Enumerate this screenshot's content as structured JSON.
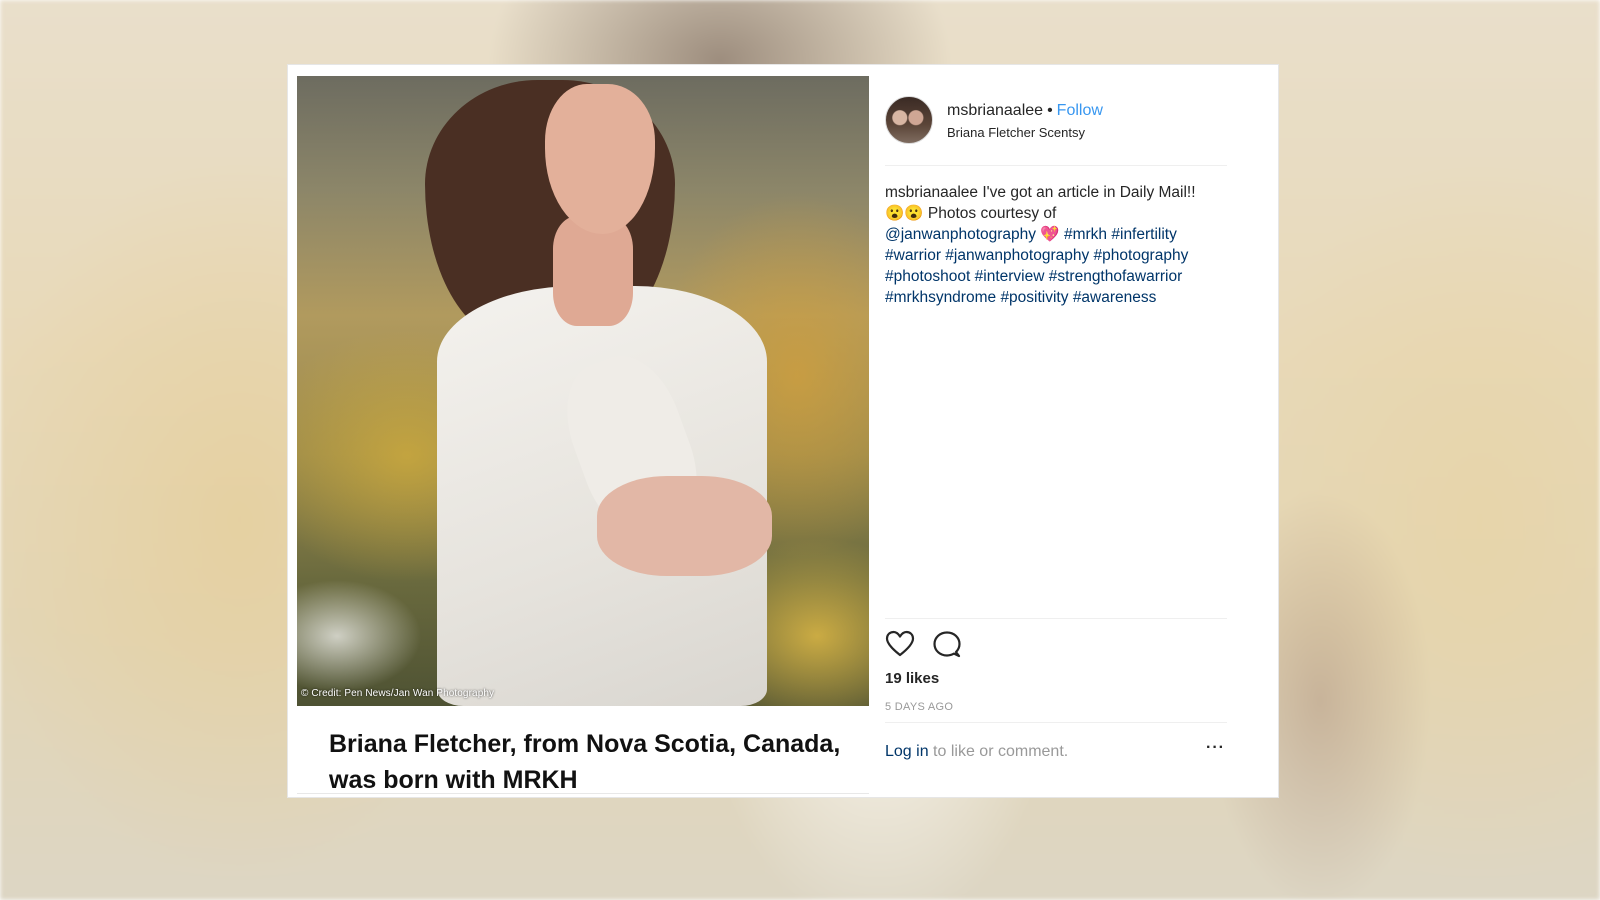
{
  "post": {
    "username": "msbrianaalee",
    "separator": "•",
    "follow_label": "Follow",
    "location": "Briana Fletcher Scentsy",
    "caption": {
      "username": "msbrianaalee",
      "text_1": "I've got an article in Daily Mail!!",
      "emoji_1": "😮😮",
      "text_2": "Photos courtesy of",
      "mention": "@janwanphotography",
      "emoji_2": "💖",
      "tags": [
        "#mrkh",
        "#infertility",
        "#warrior",
        "#janwanphotography",
        "#photography",
        "#photoshoot",
        "#interview",
        "#strengthofawarrior",
        "#mrkhsyndrome",
        "#positivity",
        "#awareness"
      ]
    },
    "likes": "19 likes",
    "time_ago": "5 DAYS AGO",
    "login_link": "Log in",
    "login_suffix": "to like or comment.",
    "more_label": "···"
  },
  "article": {
    "photo_credit": "© Credit: Pen News/Jan Wan Photography",
    "headline": "Briana Fletcher, from Nova Scotia, Canada, was born with MRKH"
  },
  "icons": {
    "like": "heart-icon",
    "comment": "comment-icon",
    "more": "more-options-icon"
  },
  "colors": {
    "link_blue": "#3897f0",
    "hashtag": "#003569",
    "muted": "#999999",
    "text": "#262626"
  }
}
